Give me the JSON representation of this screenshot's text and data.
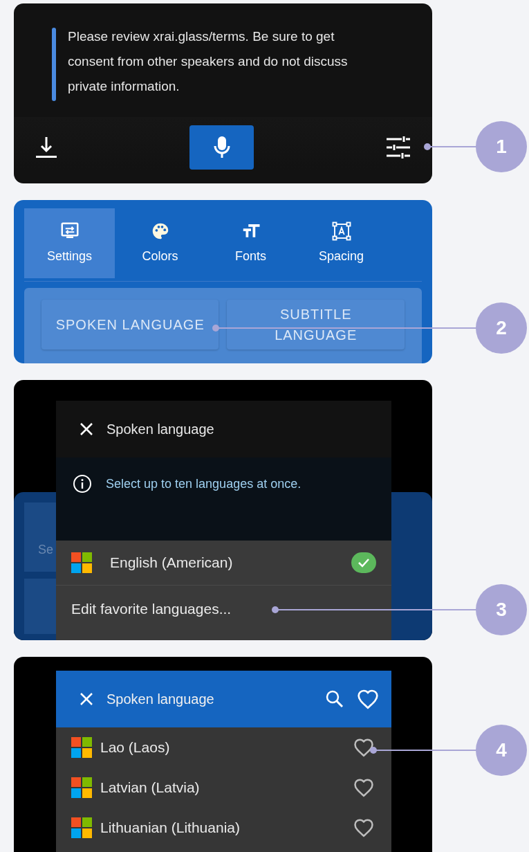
{
  "subtitle_view": {
    "message": "Please review xrai.glass/terms. Be sure to get consent from other speakers and do not discuss private information.",
    "callout": "1"
  },
  "settings_panel": {
    "tabs": [
      {
        "label": "Settings",
        "selected": true
      },
      {
        "label": "Colors",
        "selected": false
      },
      {
        "label": "Fonts",
        "selected": false
      },
      {
        "label": "Spacing",
        "selected": false
      }
    ],
    "buttons": [
      "SPOKEN LANGUAGE",
      "SUBTITLE LANGUAGE"
    ],
    "callout": "2"
  },
  "language_dialog": {
    "backdrop_texts": [
      "Se"
    ],
    "title": "Spoken language",
    "info": "Select up to ten languages at once.",
    "languages": [
      {
        "name": "English (American)",
        "checked": true
      }
    ],
    "edit_link": "Edit favorite languages...",
    "callout": "3"
  },
  "language_list": {
    "title": "Spoken language",
    "languages": [
      {
        "name": "Lao (Laos)",
        "favorite": false
      },
      {
        "name": "Latvian (Latvia)",
        "favorite": false
      },
      {
        "name": "Lithuanian (Lithuania)",
        "favorite": false
      }
    ],
    "callout": "4"
  }
}
